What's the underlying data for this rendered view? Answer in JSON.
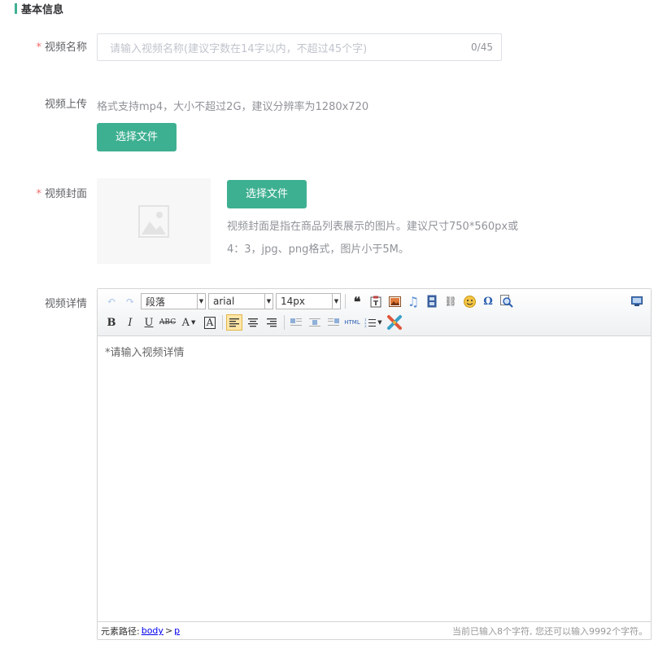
{
  "section_title": "基本信息",
  "video_name": {
    "label": "视频名称",
    "required_mark": "*",
    "placeholder": "请输入视频名称(建议字数在14字以内，不超过45个字)",
    "counter": "0/45"
  },
  "video_upload": {
    "label": "视频上传",
    "hint": "格式支持mp4，大小不超过2G，建议分辨率为1280x720",
    "button": "选择文件"
  },
  "video_cover": {
    "label": "视频封面",
    "required_mark": "*",
    "button": "选择文件",
    "hint_line1": "视频封面是指在商品列表展示的图片。建议尺寸750*560px或",
    "hint_line2": "4：3，jpg、png格式，图片小于5M。"
  },
  "video_detail": {
    "label": "视频详情",
    "toolbar": {
      "paragraph_select": "段落",
      "font_select": "arial",
      "size_select": "14px"
    },
    "content_placeholder": "*请输入视频详情",
    "status_path_label": "元素路径:",
    "status_path_body": "body",
    "status_path_sep": ">",
    "status_path_p": "p",
    "word_count": "当前已输入8个字符, 您还可以输入9992个字符。"
  },
  "colors": {
    "accent": "#3eb092",
    "required": "#f56c6c"
  }
}
